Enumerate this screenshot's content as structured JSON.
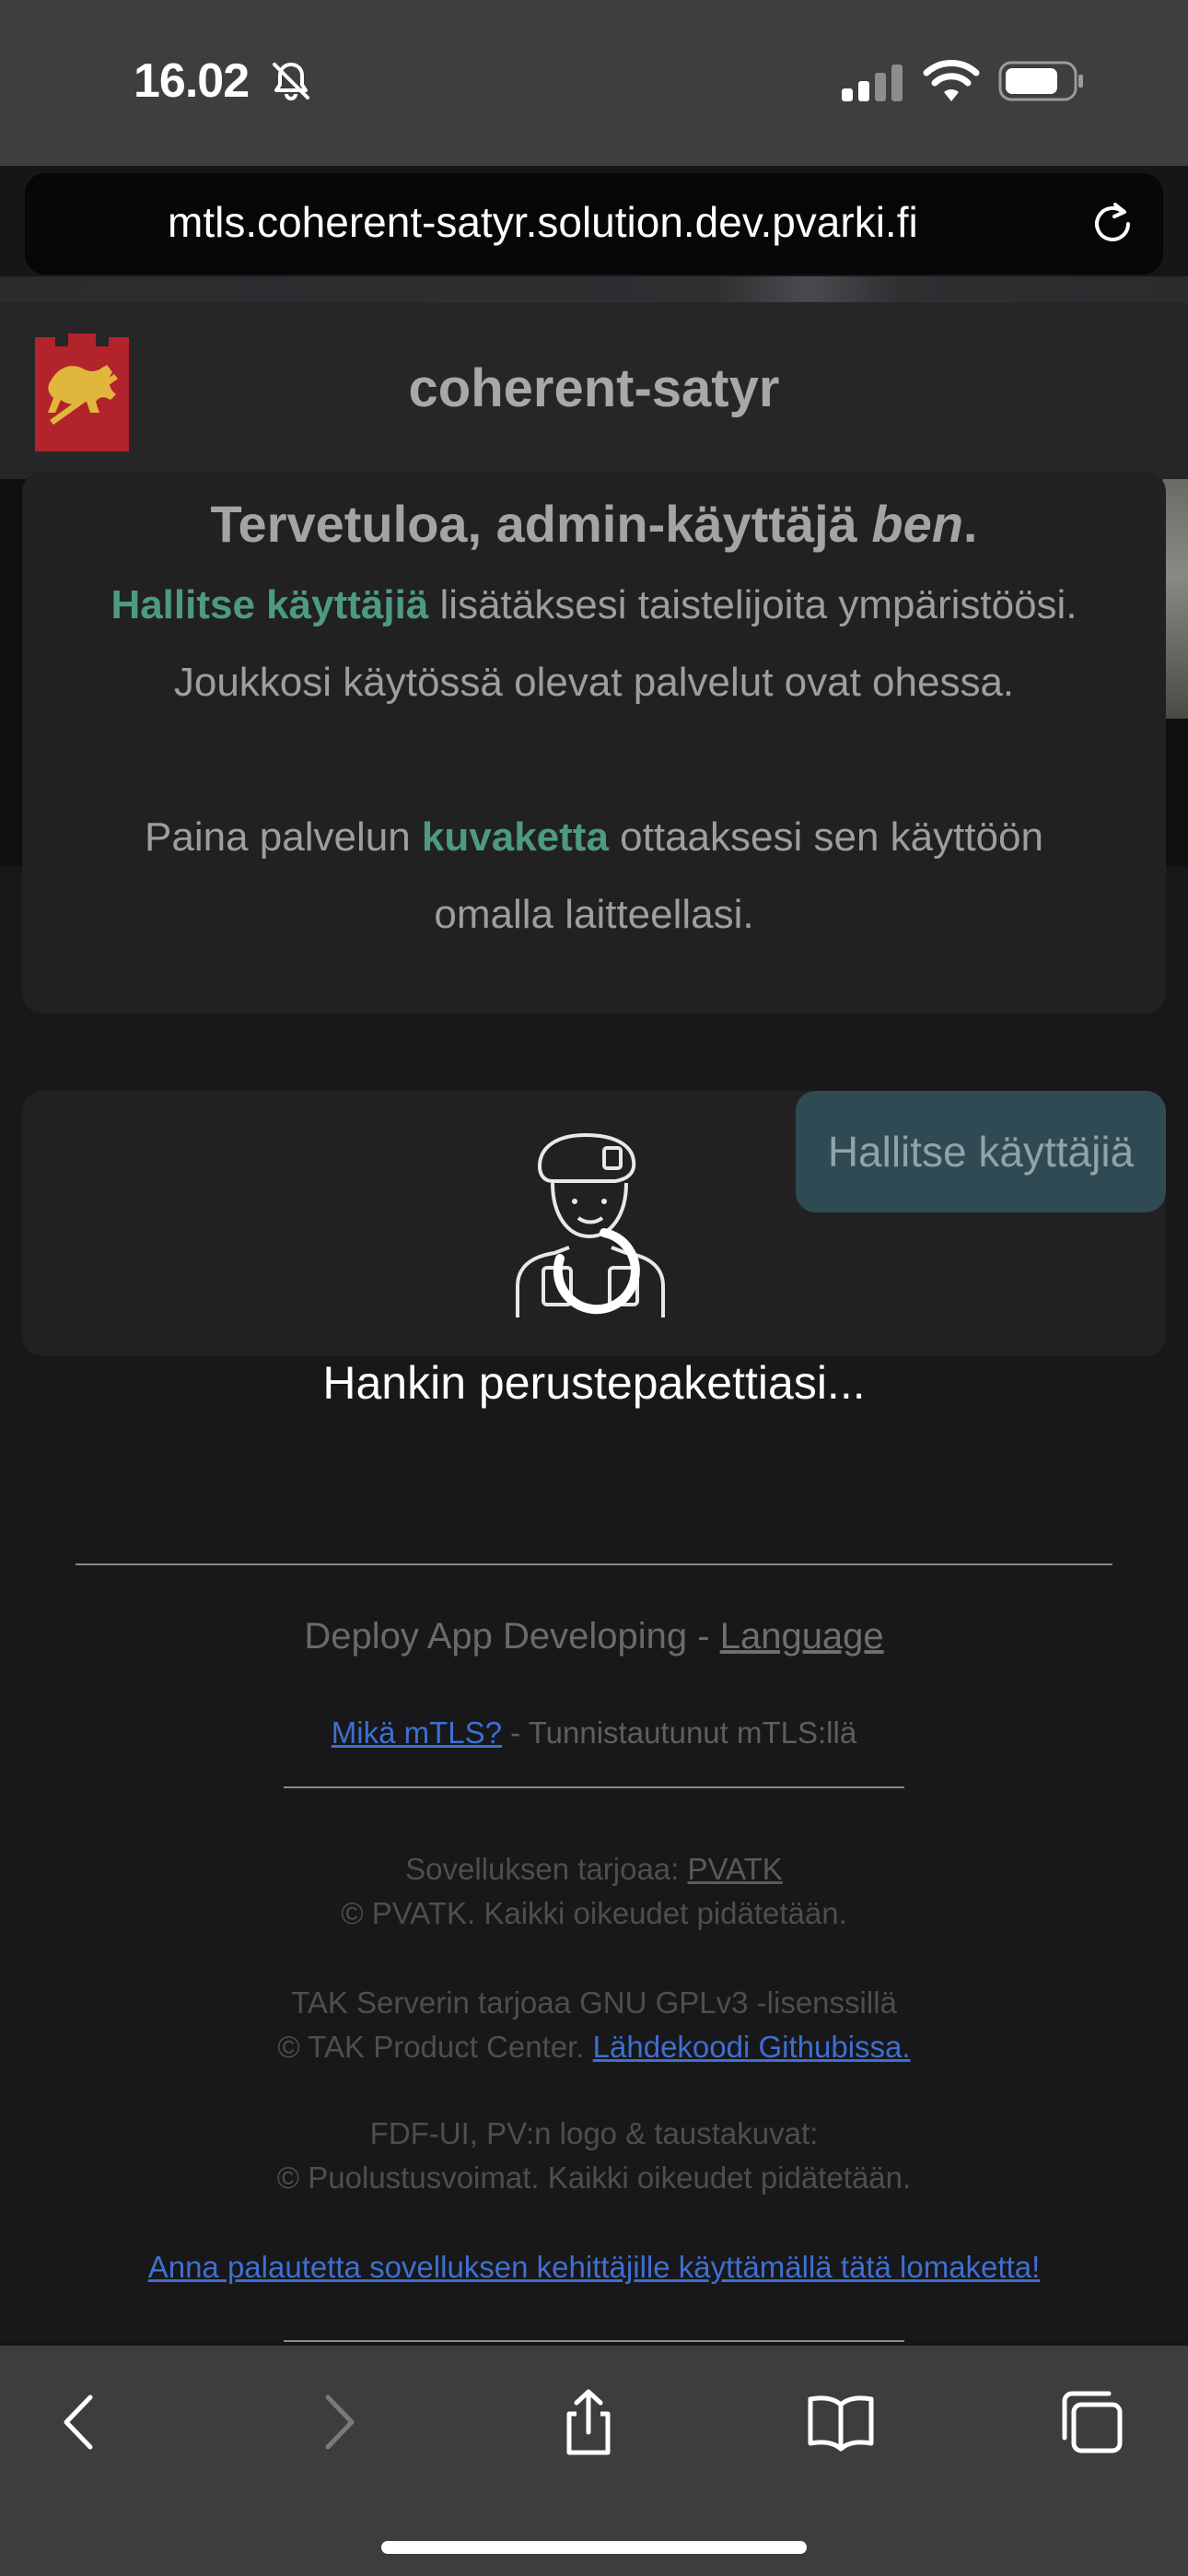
{
  "status_bar": {
    "time": "16.02",
    "icons": [
      "bell-slash-icon",
      "signal-icon",
      "wifi-icon",
      "battery-icon"
    ]
  },
  "browser": {
    "url": "mtls.coherent-satyr.solution.dev.pvarki.fi",
    "reload_icon": "reload-icon"
  },
  "header": {
    "logo": "lion-crest-logo",
    "title": "coherent-satyr"
  },
  "welcome": {
    "heading_prefix": "Tervetuloa, admin-käyttäjä ",
    "heading_name": "ben",
    "heading_suffix": ".",
    "line1_link": "Hallitse käyttäjiä",
    "line1_rest": " lisätäksesi taistelijoita ympäristöösi.",
    "line2": "Joukkosi käytössä olevat palvelut ovat ohessa.",
    "line3_prefix": "Paina palvelun ",
    "line3_link": "kuvaketta",
    "line3_suffix": " ottaaksesi sen käyttöön",
    "line4": "omalla laitteellasi."
  },
  "services": {
    "manage_users_button": "Hallitse käyttäjiä",
    "loading_text": "Hankin perustepakettiasi..."
  },
  "footer": {
    "deploy_prefix": "Deploy App Developing - ",
    "language_link": "Language",
    "mtls_link": "Mikä mTLS?",
    "mtls_rest": " - Tunnistautunut mTLS:llä",
    "provider_prefix": "Sovelluksen tarjoaa: ",
    "provider_link": "PVATK",
    "provider_copy": "© PVATK. Kaikki oikeudet pidätetään.",
    "tak_line": "TAK Serverin tarjoaa GNU GPLv3 -lisenssillä",
    "tak_copy_prefix": "© TAK Product Center. ",
    "tak_source_link": "Lähdekoodi Githubissa.",
    "fdf_line": "FDF-UI, PV:n logo & taustakuvat:",
    "fdf_copy": "© Puolustusvoimat. Kaikki oikeudet pidätetään.",
    "feedback_link": "Anna palautetta sovelluksen kehittäjille käyttämällä tätä lomaketta!"
  },
  "toolbar": {
    "items": [
      "back-icon",
      "forward-icon",
      "share-icon",
      "bookmarks-icon",
      "tabs-icon"
    ]
  },
  "colors": {
    "accent": "#4d9a82",
    "link_blue": "#3f6fd0",
    "button_bg": "#2f4a53"
  }
}
